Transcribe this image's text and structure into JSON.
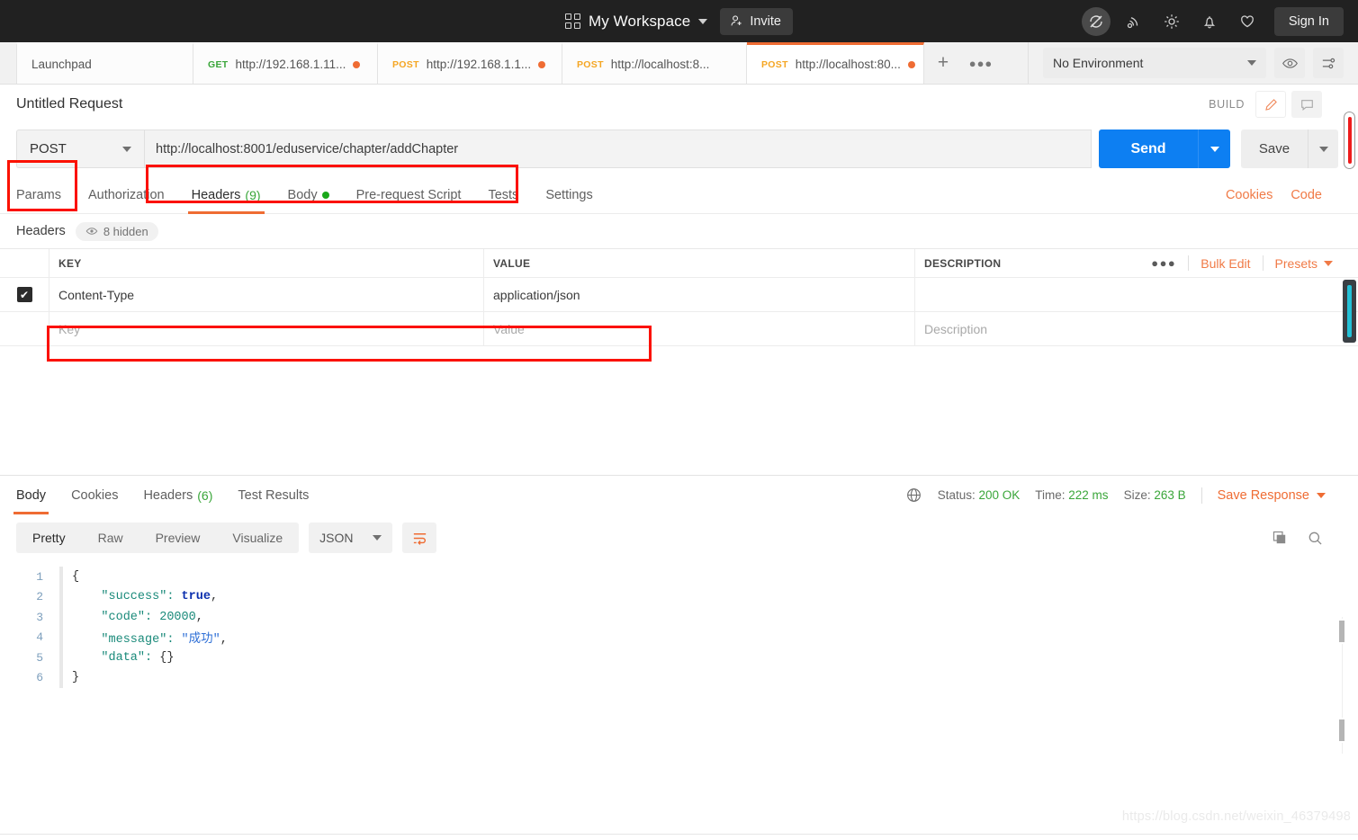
{
  "topbar": {
    "workspace": "My Workspace",
    "invite_label": "Invite",
    "signin_label": "Sign In",
    "icons": [
      "sync-off-icon",
      "antenna-icon",
      "gear-icon",
      "bell-icon",
      "heart-icon"
    ]
  },
  "tabs": [
    {
      "verb": "",
      "label": "Launchpad",
      "unsaved": false,
      "active": false
    },
    {
      "verb": "GET",
      "label": "http://192.168.1.11...",
      "unsaved": true,
      "active": false
    },
    {
      "verb": "POST",
      "label": "http://192.168.1.1...",
      "unsaved": true,
      "active": false
    },
    {
      "verb": "POST",
      "label": "http://localhost:8...",
      "unsaved": false,
      "active": false
    },
    {
      "verb": "POST",
      "label": "http://localhost:80...",
      "unsaved": true,
      "active": true
    }
  ],
  "tab_actions": {
    "new_tab": "+",
    "more": "●●●"
  },
  "environment": {
    "selected": "No Environment",
    "eye_icon": "eye-icon",
    "settings_icon": "sliders-icon"
  },
  "request": {
    "title": "Untitled Request",
    "build_label": "BUILD",
    "method": "POST",
    "url": "http://localhost:8001/eduservice/chapter/addChapter",
    "send_label": "Send",
    "save_label": "Save",
    "tabs": [
      {
        "label": "Params",
        "count": "",
        "dot": false,
        "selected": false
      },
      {
        "label": "Authorization",
        "count": "",
        "dot": false,
        "selected": false
      },
      {
        "label": "Headers",
        "count": "(9)",
        "dot": false,
        "selected": true
      },
      {
        "label": "Body",
        "count": "",
        "dot": true,
        "selected": false
      },
      {
        "label": "Pre-request Script",
        "count": "",
        "dot": false,
        "selected": false
      },
      {
        "label": "Tests",
        "count": "",
        "dot": false,
        "selected": false
      },
      {
        "label": "Settings",
        "count": "",
        "dot": false,
        "selected": false
      }
    ],
    "links": [
      {
        "label": "Cookies"
      },
      {
        "label": "Code"
      }
    ]
  },
  "headers_panel": {
    "section_label": "Headers",
    "hidden_label": "8 hidden",
    "columns": [
      "KEY",
      "VALUE",
      "DESCRIPTION"
    ],
    "tools": {
      "more": "●●●",
      "bulk_edit": "Bulk Edit",
      "presets": "Presets"
    },
    "rows": [
      {
        "checked": true,
        "key": "Content-Type",
        "value": "application/json",
        "description": ""
      }
    ],
    "placeholder_row": {
      "key": "Key",
      "value": "Value",
      "description": "Description"
    }
  },
  "response": {
    "tabs": [
      {
        "label": "Body",
        "count": "",
        "selected": true
      },
      {
        "label": "Cookies",
        "count": "",
        "selected": false
      },
      {
        "label": "Headers",
        "count": "(6)",
        "selected": false
      },
      {
        "label": "Test Results",
        "count": "",
        "selected": false
      }
    ],
    "globe_icon": "globe-icon",
    "status_label": "Status:",
    "status_value": "200 OK",
    "time_label": "Time:",
    "time_value": "222 ms",
    "size_label": "Size:",
    "size_value": "263 B",
    "save_response": "Save Response",
    "format_tabs": [
      "Pretty",
      "Raw",
      "Preview",
      "Visualize"
    ],
    "format_selected": "Pretty",
    "language": "JSON",
    "wrap_icon": "word-wrap-icon",
    "copy_icon": "copy-icon",
    "search_icon": "search-icon",
    "body_lines": [
      {
        "no": "1",
        "tokens": [
          {
            "t": "{",
            "c": "punc"
          }
        ]
      },
      {
        "no": "2",
        "tokens": [
          {
            "t": "    \"success\": ",
            "c": "key"
          },
          {
            "t": "true",
            "c": "bool"
          },
          {
            "t": ",",
            "c": "punc"
          }
        ]
      },
      {
        "no": "3",
        "tokens": [
          {
            "t": "    \"code\": ",
            "c": "key"
          },
          {
            "t": "20000",
            "c": "num"
          },
          {
            "t": ",",
            "c": "punc"
          }
        ]
      },
      {
        "no": "4",
        "tokens": [
          {
            "t": "    \"message\": ",
            "c": "key"
          },
          {
            "t": "\"成功\"",
            "c": "str"
          },
          {
            "t": ",",
            "c": "punc"
          }
        ]
      },
      {
        "no": "5",
        "tokens": [
          {
            "t": "    \"data\": ",
            "c": "key"
          },
          {
            "t": "{}",
            "c": "punc"
          }
        ]
      },
      {
        "no": "6",
        "tokens": [
          {
            "t": "}",
            "c": "punc"
          }
        ]
      }
    ]
  },
  "watermark": "https://blog.csdn.net/weixin_46379498",
  "colors": {
    "accent_orange": "#ef6c33",
    "send_blue": "#0d7ff2",
    "green": "#3aa63a",
    "highlight_red": "#fb1100",
    "topbar_dark": "#212121"
  }
}
